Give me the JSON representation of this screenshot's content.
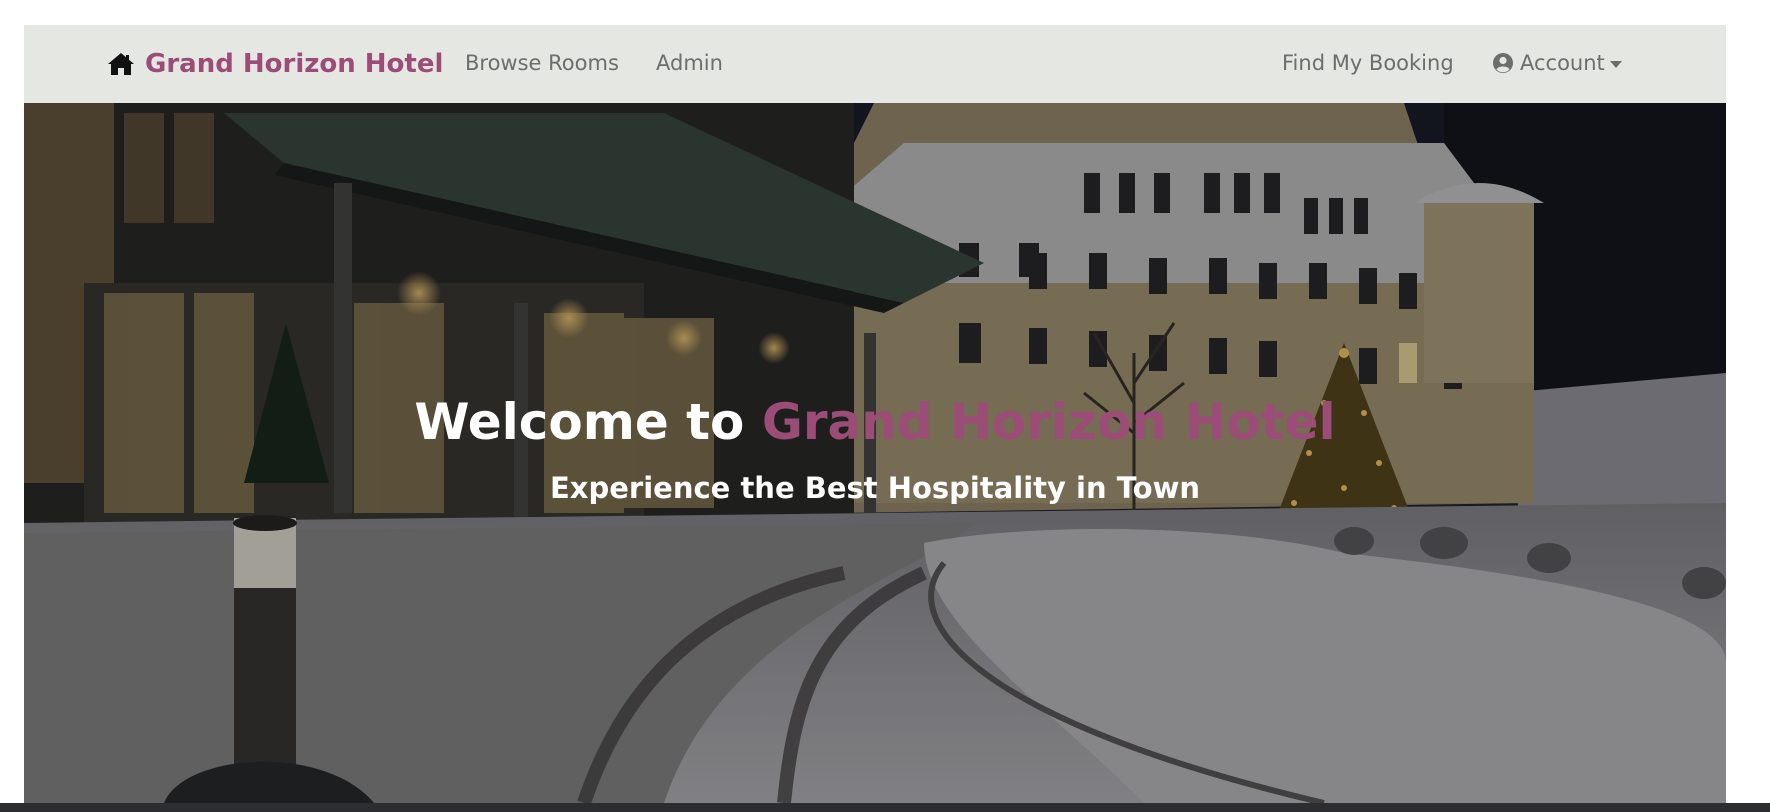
{
  "brand": {
    "name": "Grand Horizon Hotel",
    "color": "#9b4d78",
    "icon": "home-icon"
  },
  "nav": {
    "left_items": [
      {
        "label": "Browse Rooms"
      },
      {
        "label": "Admin"
      }
    ],
    "right_items": [
      {
        "label": "Find My Booking"
      },
      {
        "label": "Account",
        "icon": "user-circle-icon",
        "has_dropdown": true
      }
    ]
  },
  "hero": {
    "title_prefix": "Welcome to ",
    "title_accent": "Grand Horizon Hotel",
    "subtitle": "Experience the Best Hospitality in Town",
    "image": "snowy hotel entrance at night"
  },
  "colors": {
    "navbar_bg": "#e5e7e3",
    "nav_text": "#6c6e6c",
    "accent": "#9b4d78",
    "hero_text": "#ffffff"
  }
}
